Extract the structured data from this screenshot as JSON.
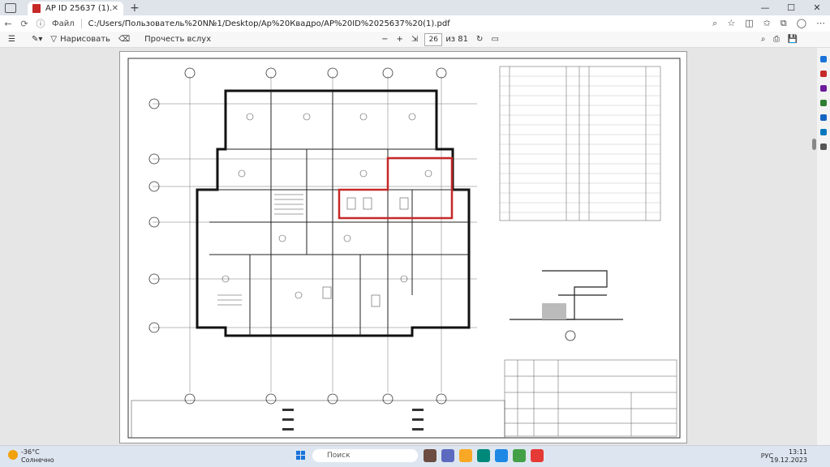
{
  "browser": {
    "tab_title": "АР ID 25637 (1).pdf",
    "address_label": "Файл",
    "url": "C:/Users/Пользователь%20N№1/Desktop/Ap%20Квадро/AP%20ID%2025637%20(1).pdf"
  },
  "pdf_toolbar": {
    "draw_label": "Нарисовать",
    "read_aloud_label": "Прочесть вслух",
    "current_page": "26",
    "page_total": "из 81"
  },
  "taskbar": {
    "weather_temp": "-36°C",
    "weather_desc": "Солнечно",
    "search_placeholder": "Поиск",
    "lang": "РУС",
    "time": "13:11",
    "date": "19.12.2023"
  },
  "colors": {
    "accent": "#1a73d9",
    "highlight": "#c62828"
  }
}
